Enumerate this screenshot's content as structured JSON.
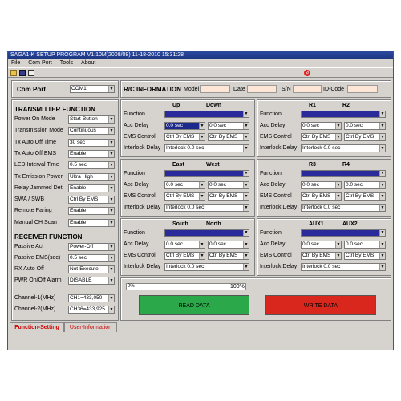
{
  "window": {
    "title": "SAGA1-K SETUP PROGRAM V1.10M(2008/08)  11-18-2010  15:31:28"
  },
  "menu": [
    "File",
    "Com Port",
    "Tools",
    "About"
  ],
  "toolbar": {
    "icons": [
      "open-icon",
      "save-icon",
      "print-icon",
      "stop-icon"
    ]
  },
  "com_port": {
    "label": "Com Port",
    "value": "COM1"
  },
  "rc_info": {
    "title": "R/C INFORMATION",
    "model_label": "Model",
    "date_label": "Date",
    "sn_label": "S/N",
    "idcode_label": "ID-Code"
  },
  "transmitter": {
    "title": "TRANSMITTER FUNCTION",
    "rows": [
      {
        "label": "Power On Mode",
        "value": "Start-Button"
      },
      {
        "label": "Transmission Mode",
        "value": "Continuous"
      },
      {
        "label": "Tx Auto Off Time",
        "value": "30 sec"
      },
      {
        "label": "Tx Auto Off EMS",
        "value": "Enable"
      },
      {
        "label": "LED Interval Time",
        "value": "0.5 sec"
      },
      {
        "label": "Tx Emission Power",
        "value": "Ultra High"
      },
      {
        "label": "Relay Jammed Det.",
        "value": "Enable"
      },
      {
        "label": "SWA  /  SWB",
        "value": "Ctrl By EMS"
      },
      {
        "label": "Remote Paring",
        "value": "Enable"
      },
      {
        "label": "Manual CH Scan",
        "value": "Enable"
      }
    ]
  },
  "receiver": {
    "title": "RECEIVER FUNCTION",
    "rows": [
      {
        "label": "Passive Act",
        "value": "Power-Off"
      },
      {
        "label": "Passive EMS(sec)",
        "value": "0.5 sec"
      },
      {
        "label": "RX Auto Off",
        "value": "Not-Execute"
      },
      {
        "label": "PWR On/Off Alarm",
        "value": "DISABLE"
      }
    ]
  },
  "channels": [
    {
      "label": "Channel-1(MHz)",
      "value": "CH1=433,050"
    },
    {
      "label": "Channel-2(MHz)",
      "value": "CH36=433,925"
    }
  ],
  "row_labels": {
    "function": "Function",
    "acc_delay": "Acc Delay",
    "ems_control": "EMS Control",
    "interlock_delay": "Interlock Delay"
  },
  "groups": [
    {
      "h1": "Up",
      "h2": "Down",
      "acc1": "0.0 sec",
      "acc2": "0.0 sec",
      "ems1": "Ctrl By EMS",
      "ems2": "Ctrl By EMS",
      "interlock": "Interlock 0.0 sec"
    },
    {
      "h1": "R1",
      "h2": "R2",
      "acc1": "0.0 sec",
      "acc2": "0.0 sec",
      "ems1": "Ctrl By EMS",
      "ems2": "Ctrl By EMS",
      "interlock": "Interlock 0.0 sec"
    },
    {
      "h1": "East",
      "h2": "West",
      "acc1": "0.0 sec",
      "acc2": "0.0 sec",
      "ems1": "Ctrl By EMS",
      "ems2": "Ctrl By EMS",
      "interlock": "Interlock 0.0 sec"
    },
    {
      "h1": "R3",
      "h2": "R4",
      "acc1": "0.0 sec",
      "acc2": "0.0 sec",
      "ems1": "Ctrl By EMS",
      "ems2": "Ctrl By EMS",
      "interlock": "Interlock 0.0 sec"
    },
    {
      "h1": "South",
      "h2": "North",
      "acc1": "0.0 sec",
      "acc2": "0.0 sec",
      "ems1": "Ctrl By EMS",
      "ems2": "Ctrl By EMS",
      "interlock": "Interlock 0.0 sec"
    },
    {
      "h1": "AUX1",
      "h2": "AUX2",
      "acc1": "0.0 sec",
      "acc2": "0.0 sec",
      "ems1": "Ctrl By EMS",
      "ems2": "Ctrl By EMS",
      "interlock": "Interlock 0.0 sec"
    }
  ],
  "progress": {
    "start": "0%",
    "end": "100%",
    "fraction": 0
  },
  "buttons": {
    "read": "READ  DATA",
    "write": "WRITE DATA",
    "read_color": "#2aa84a",
    "write_color": "#d9271d"
  },
  "tabs": [
    "Function-Setting",
    "User-Information"
  ]
}
